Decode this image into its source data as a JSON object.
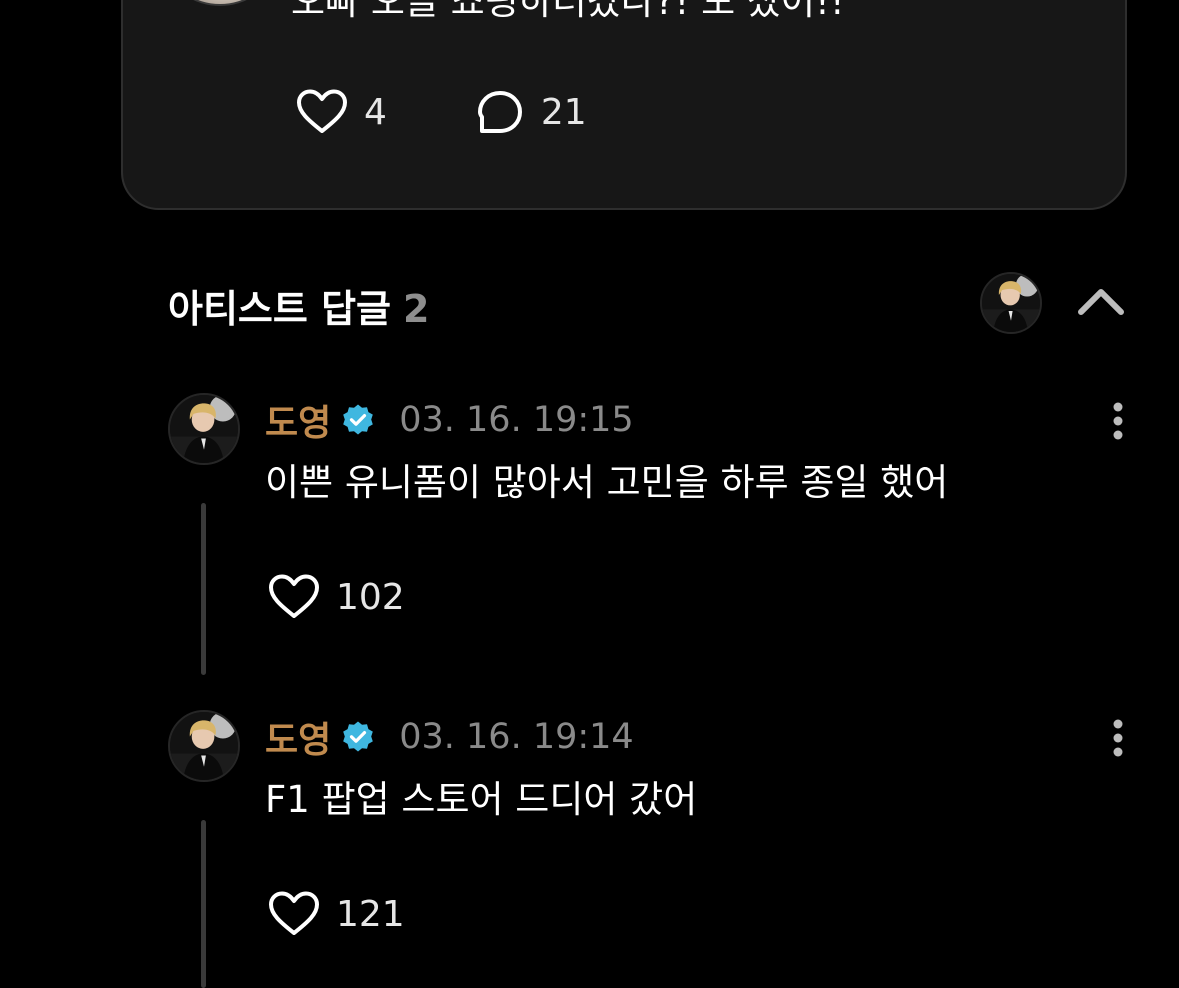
{
  "post": {
    "text": "오빠 오늘 쇼핑하러갔나?! 모 샀어!!",
    "likes": "4",
    "comments": "21",
    "icons": {
      "like": "heart-outline-icon",
      "comment": "speech-bubble-icon"
    }
  },
  "replies_section": {
    "title": "아티스트 답글",
    "count": "2",
    "collapse_icon": "chevron-up-icon"
  },
  "replies": [
    {
      "author": "도영",
      "verified": true,
      "timestamp": "03. 16. 19:15",
      "text": "이쁜 유니폼이 많아서 고민을 하루 종일 했어",
      "likes": "102"
    },
    {
      "author": "도영",
      "verified": true,
      "timestamp": "03. 16. 19:14",
      "text": "F1 팝업 스토어 드디어 갔어",
      "likes": "121"
    }
  ],
  "colors": {
    "background": "#000000",
    "card": "#171717",
    "author": "#c08a4e",
    "verified_badge": "#3fb7e0",
    "timestamp": "#8a8a8a",
    "reply_count": "#8e8e8e"
  }
}
